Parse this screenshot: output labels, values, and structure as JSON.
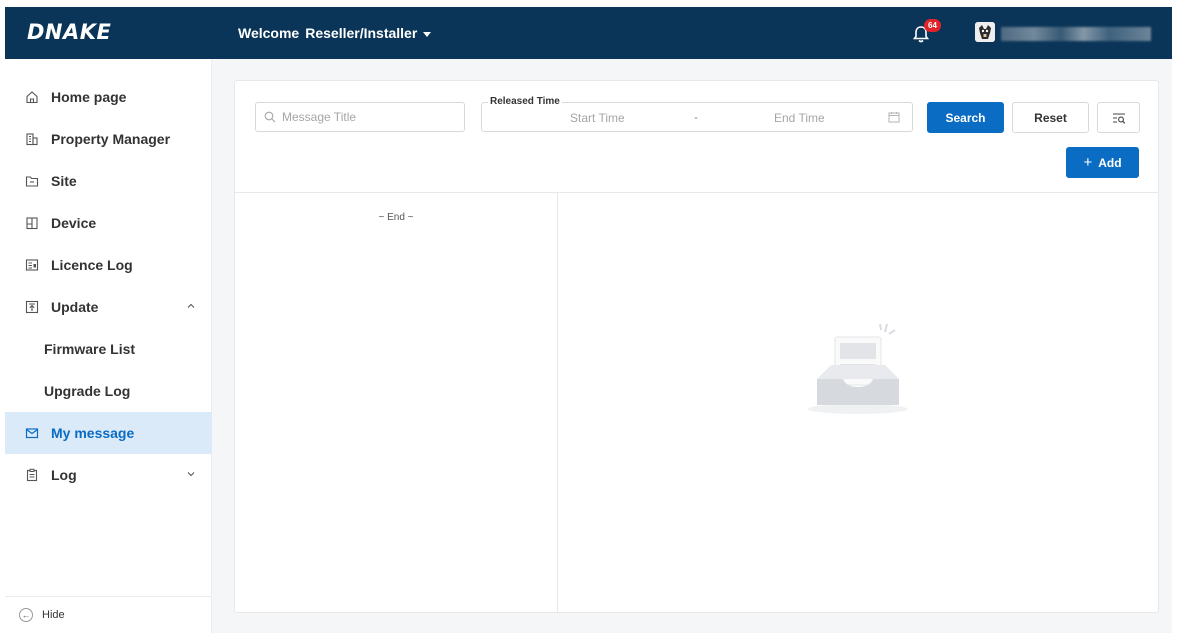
{
  "header": {
    "logo": "DNAKE",
    "welcome_label": "Welcome",
    "role": "Reseller/Installer",
    "notification_count": "64"
  },
  "sidebar": {
    "items": [
      {
        "label": "Home page",
        "icon": "home-icon"
      },
      {
        "label": "Property Manager",
        "icon": "building-icon"
      },
      {
        "label": "Site",
        "icon": "folder-icon"
      },
      {
        "label": "Device",
        "icon": "device-icon"
      },
      {
        "label": "Licence Log",
        "icon": "licence-icon"
      },
      {
        "label": "Update",
        "icon": "upload-icon",
        "expanded": true
      },
      {
        "label": "Firmware List"
      },
      {
        "label": "Upgrade Log"
      },
      {
        "label": "My message",
        "icon": "mail-icon",
        "active": true
      },
      {
        "label": "Log",
        "icon": "clipboard-icon",
        "expanded": false
      }
    ],
    "hide_label": "Hide"
  },
  "filters": {
    "message_title_placeholder": "Message Title",
    "released_time_label": "Released Time",
    "start_time_placeholder": "Start Time",
    "range_separator": "-",
    "end_time_placeholder": "End Time"
  },
  "buttons": {
    "search": "Search",
    "reset": "Reset",
    "add": "Add"
  },
  "message_list": {
    "end_text": "~ End ~"
  },
  "colors": {
    "header_bg": "#0b3558",
    "primary": "#0a6cc2",
    "active_item_bg": "#dbeaf9",
    "badge": "#e0242a"
  }
}
